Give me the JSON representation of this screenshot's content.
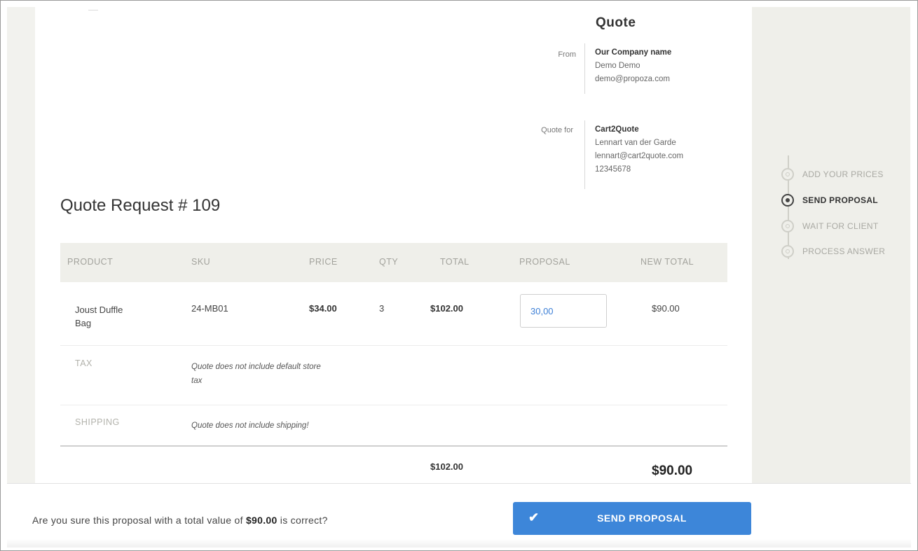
{
  "quote": {
    "title": "Quote",
    "from": {
      "label": "From",
      "name": "Our Company name",
      "lines": [
        "Demo Demo",
        "demo@propoza.com"
      ]
    },
    "quote_for": {
      "label": "Quote for",
      "name": "Cart2Quote",
      "lines": [
        "Lennart van der Garde",
        "lennart@cart2quote.com",
        "12345678"
      ]
    },
    "request_title": "Quote Request # 109"
  },
  "table": {
    "headers": [
      "PRODUCT",
      "SKU",
      "PRICE",
      "QTY",
      "TOTAL",
      "PROPOSAL",
      "NEW TOTAL"
    ],
    "item": {
      "product": "Joust Duffle Bag",
      "sku": "24-MB01",
      "price": "$34.00",
      "qty": "3",
      "total": "$102.00",
      "proposal": "30,00",
      "new_total": "$90.00"
    },
    "tax": {
      "label": "TAX",
      "note": "Quote does not include default store tax"
    },
    "shipping": {
      "label": "SHIPPING",
      "note": "Quote does not include shipping!"
    },
    "totals": {
      "total": "$102.00",
      "new_total": "$90.00"
    }
  },
  "steps": [
    {
      "label": "ADD YOUR PRICES",
      "active": false
    },
    {
      "label": "SEND PROPOSAL",
      "active": true
    },
    {
      "label": "WAIT FOR CLIENT",
      "active": false
    },
    {
      "label": "PROCESS ANSWER",
      "active": false
    }
  ],
  "footer": {
    "confirm_prefix": "Are you sure this proposal with a total value of ",
    "confirm_value": "$90.00",
    "confirm_suffix": " is correct?",
    "button_label": "SEND PROPOSAL",
    "button_icon": "check-icon"
  },
  "colors": {
    "accent": "#3d86d9",
    "panel": "#efefea",
    "proposal_text": "#3d7fd6"
  }
}
